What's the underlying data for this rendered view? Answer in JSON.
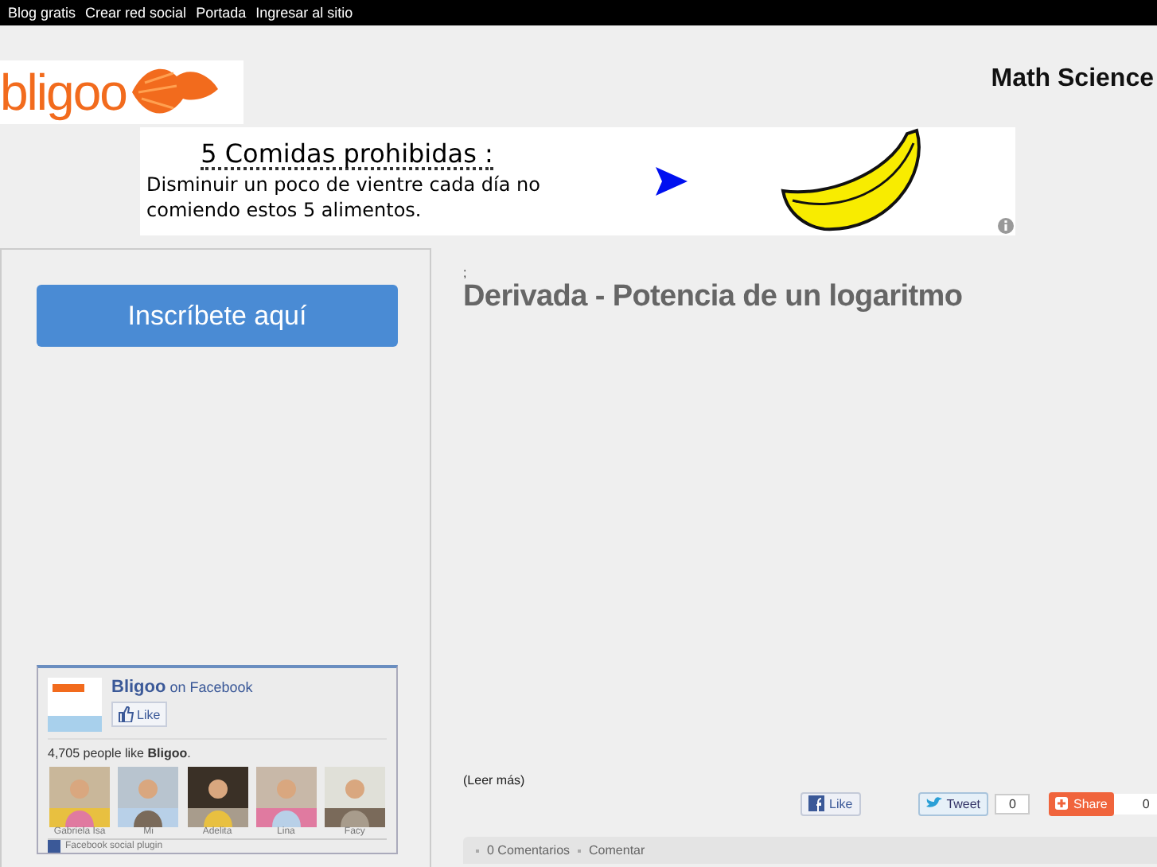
{
  "top_nav": [
    "Blog gratis",
    "Crear red social",
    "Portada",
    "Ingresar al sitio"
  ],
  "logo": "bligoo",
  "site_title": "Math Science",
  "ad": {
    "headline": "5 Comidas prohibidas :",
    "body": "Disminuir un poco de vientre cada día no comiendo estos 5 alimentos."
  },
  "sidebar": {
    "signup_button": "Inscríbete aquí",
    "facebook": {
      "page": "Bligoo",
      "suffix": "on Facebook",
      "like": "Like",
      "count_text": "4,705 people like **Bligoo**.",
      "fans": [
        {
          "name": "Gabriela Isa",
          "kind": "picture"
        },
        {
          "name": "Mi",
          "kind": "picture"
        },
        {
          "name": "Adelita",
          "kind": "picture"
        },
        {
          "name": "Lina",
          "kind": "picture"
        },
        {
          "name": "Facy",
          "kind": "picture"
        }
      ],
      "footer": "Facebook social plugin"
    }
  },
  "post": {
    "mark": ";",
    "title": "Derivada - Potencia de un logaritmo",
    "read_more": "(Leer más)",
    "like": "Like",
    "tweet": "Tweet",
    "tweet_count": "0",
    "share": "Share",
    "share_count": "0",
    "comments": "0 Comentarios",
    "comment_link": "Comentar"
  }
}
